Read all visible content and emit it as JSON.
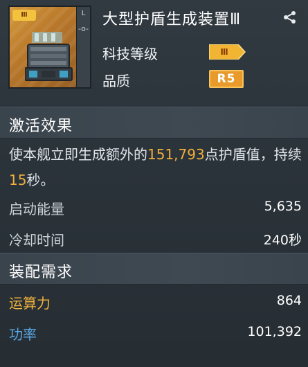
{
  "item": {
    "name": "大型护盾生成装置Ⅲ",
    "thumb_rank": "Ⅲ",
    "thumb_side_letter": "L",
    "thumb_side_symbol": "-o-"
  },
  "attributes": {
    "tech_level_label": "科技等级",
    "tech_level_value": "Ⅲ",
    "quality_label": "品质",
    "quality_value": "R5"
  },
  "activation": {
    "header": "激活效果",
    "desc_prefix": "使本舰立即生成额外的",
    "shield_amount": "151,793",
    "desc_middle": "点护盾值，持续",
    "duration": "15",
    "desc_suffix": "秒。",
    "stats": [
      {
        "label": "启动能量",
        "value": "5,635"
      },
      {
        "label": "冷却时间",
        "value": "240秒"
      }
    ]
  },
  "requirements": {
    "header": "装配需求",
    "stats": [
      {
        "label": "运算力",
        "value": "864"
      },
      {
        "label": "功率",
        "value": "101,392"
      }
    ]
  },
  "icons": {
    "share": "share-icon",
    "device": "shield-generator-icon"
  },
  "colors": {
    "highlight": "#f0b03a",
    "compute_label": "#f0b23c",
    "power_label": "#59a9e8",
    "grade_badge": "#e89a2a"
  }
}
